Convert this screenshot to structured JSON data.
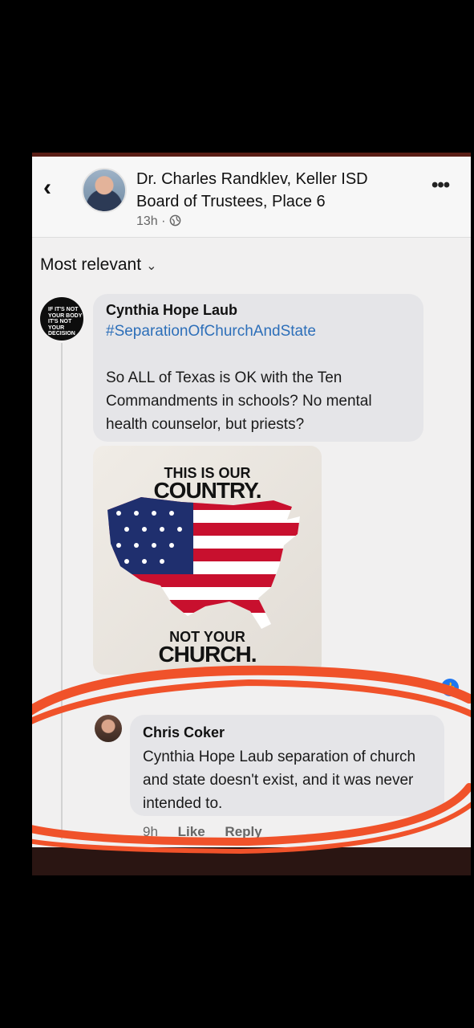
{
  "header": {
    "back_icon": "chevron-left-icon",
    "title": "Dr. Charles Randklev, Keller ISD Board of Trustees, Place 6",
    "meta": "13h · ",
    "more_icon": "more-horizontal-icon"
  },
  "sort": {
    "label": "Most relevant",
    "chevron": "⌄"
  },
  "comment1": {
    "avatar_text": [
      "IF IT'S NOT",
      "YOUR BODY",
      "IT'S NOT YOUR",
      "DECISION"
    ],
    "author": "Cynthia Hope Laub",
    "hashtag": "#SeparationOfChurchAndState",
    "text": "So ALL of Texas is OK with the Ten Commandments in schools? No mental health counselor, but priests?",
    "image": {
      "top_line1": "THIS IS OUR",
      "top_line2": "COUNTRY.",
      "bottom_line1": "NOT YOUR",
      "bottom_line2": "CHURCH."
    }
  },
  "comment2": {
    "author": "Chris Coker",
    "text": "Cynthia Hope Laub separation of church and state doesn't exist, and it was never intended to.",
    "time": "9h",
    "like": "Like",
    "reply": "Reply"
  },
  "colors": {
    "link": "#2d6fb9",
    "annotation_ring": "#f0522a",
    "reaction": "#1f77f2"
  }
}
